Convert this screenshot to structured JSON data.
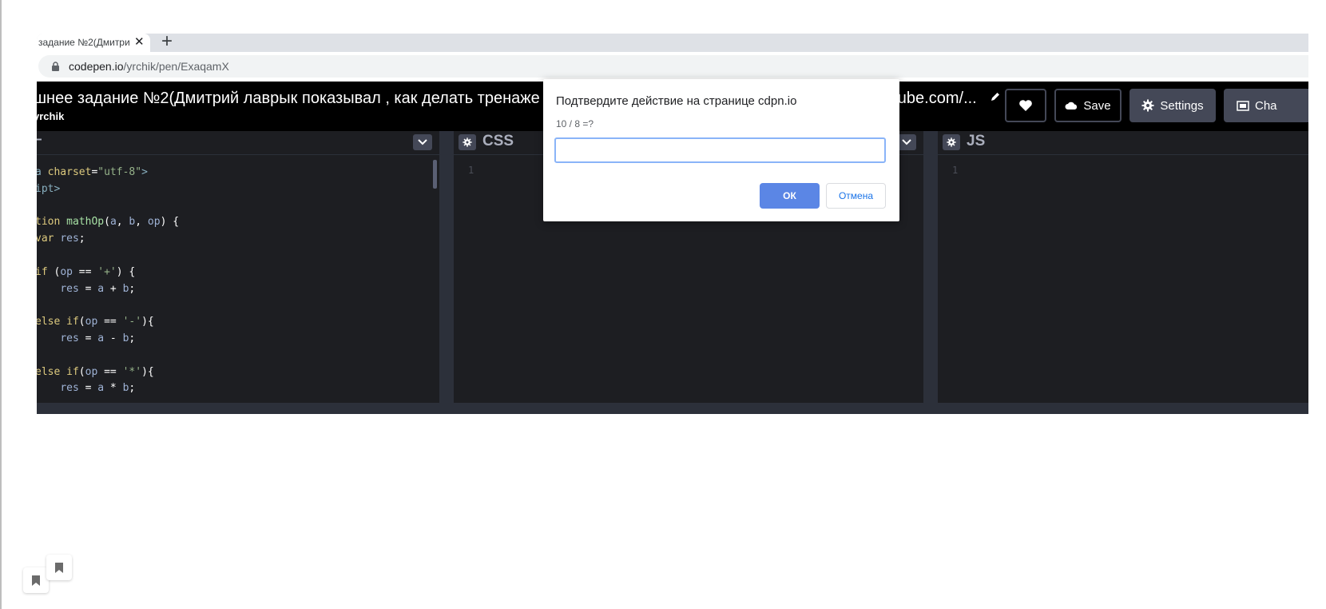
{
  "browser": {
    "tab_title": "задание №2(Дмитри",
    "tab_close": "✕",
    "new_tab": "+",
    "url_host": "codepen.io",
    "url_path": "/yrchik/pen/ExaqamX"
  },
  "codepen": {
    "pen_title": "шнее задание №2(Дмитрий лаврык показывал , как делать тренаже",
    "pen_title_tail": "outube.com/...",
    "author": "yrchik",
    "buttons": {
      "save": "Save",
      "settings": "Settings",
      "change_view": "Cha"
    },
    "editors": {
      "html": {
        "name": "–",
        "code": [
          [
            {
              "t": "a ",
              "c": "t-tag"
            },
            {
              "t": "charset",
              "c": "t-attr"
            },
            {
              "t": "=",
              "c": ""
            },
            {
              "t": "\"utf-8\"",
              "c": "t-str"
            },
            {
              "t": ">",
              "c": "t-tag"
            }
          ],
          [
            {
              "t": "ipt>",
              "c": "t-tag"
            }
          ],
          [
            {
              "t": "",
              "c": ""
            }
          ],
          [
            {
              "t": "tion ",
              "c": "t-kw"
            },
            {
              "t": "mathOp",
              "c": "t-fn"
            },
            {
              "t": "(",
              "c": ""
            },
            {
              "t": "a",
              "c": "t-var"
            },
            {
              "t": ", ",
              "c": ""
            },
            {
              "t": "b",
              "c": "t-var"
            },
            {
              "t": ", ",
              "c": ""
            },
            {
              "t": "op",
              "c": "t-var"
            },
            {
              "t": ") {",
              "c": ""
            }
          ],
          [
            {
              "t": "var ",
              "c": "t-kw"
            },
            {
              "t": "res",
              "c": "t-var"
            },
            {
              "t": ";",
              "c": ""
            }
          ],
          [
            {
              "t": "",
              "c": ""
            }
          ],
          [
            {
              "t": "if ",
              "c": "t-kw"
            },
            {
              "t": "(",
              "c": ""
            },
            {
              "t": "op",
              "c": "t-var"
            },
            {
              "t": " == ",
              "c": ""
            },
            {
              "t": "'+'",
              "c": "t-str"
            },
            {
              "t": ") {",
              "c": ""
            }
          ],
          [
            {
              "t": "    ",
              "c": ""
            },
            {
              "t": "res",
              "c": "t-var"
            },
            {
              "t": " = ",
              "c": ""
            },
            {
              "t": "a",
              "c": "t-var"
            },
            {
              "t": " + ",
              "c": ""
            },
            {
              "t": "b",
              "c": "t-var"
            },
            {
              "t": ";",
              "c": ""
            }
          ],
          [
            {
              "t": "",
              "c": ""
            }
          ],
          [
            {
              "t": "else if",
              "c": "t-kw"
            },
            {
              "t": "(",
              "c": ""
            },
            {
              "t": "op",
              "c": "t-var"
            },
            {
              "t": " == ",
              "c": ""
            },
            {
              "t": "'-'",
              "c": "t-str"
            },
            {
              "t": "){",
              "c": ""
            }
          ],
          [
            {
              "t": "    ",
              "c": ""
            },
            {
              "t": "res",
              "c": "t-var"
            },
            {
              "t": " = ",
              "c": ""
            },
            {
              "t": "a",
              "c": "t-var"
            },
            {
              "t": " - ",
              "c": ""
            },
            {
              "t": "b",
              "c": "t-var"
            },
            {
              "t": ";",
              "c": ""
            }
          ],
          [
            {
              "t": "",
              "c": ""
            }
          ],
          [
            {
              "t": "else if",
              "c": "t-kw"
            },
            {
              "t": "(",
              "c": ""
            },
            {
              "t": "op",
              "c": "t-var"
            },
            {
              "t": " == ",
              "c": ""
            },
            {
              "t": "'*'",
              "c": "t-str"
            },
            {
              "t": "){",
              "c": ""
            }
          ],
          [
            {
              "t": "    ",
              "c": ""
            },
            {
              "t": "res",
              "c": "t-var"
            },
            {
              "t": " = ",
              "c": ""
            },
            {
              "t": "a",
              "c": "t-var"
            },
            {
              "t": " * ",
              "c": ""
            },
            {
              "t": "b",
              "c": "t-var"
            },
            {
              "t": ";",
              "c": ""
            }
          ]
        ]
      },
      "css": {
        "name": "CSS",
        "line_number": "1"
      },
      "js": {
        "name": "JS",
        "line_number": "1"
      }
    }
  },
  "dialog": {
    "title": "Подтвердите действие на странице cdpn.io",
    "message": "10 / 8 =?",
    "input_value": "",
    "ok": "ОК",
    "cancel": "Отмена"
  },
  "icons": {
    "lock": "lock-icon",
    "pencil": "pencil-icon",
    "heart": "heart-icon",
    "cloud": "cloud-icon",
    "gear": "gear-icon",
    "layout": "layout-icon",
    "chevron": "chevron-down-icon",
    "bookmark": "bookmark-icon"
  },
  "colors": {
    "accent": "#5b86e5",
    "editor_bg": "#1d1e22",
    "header_bg": "#000000"
  }
}
